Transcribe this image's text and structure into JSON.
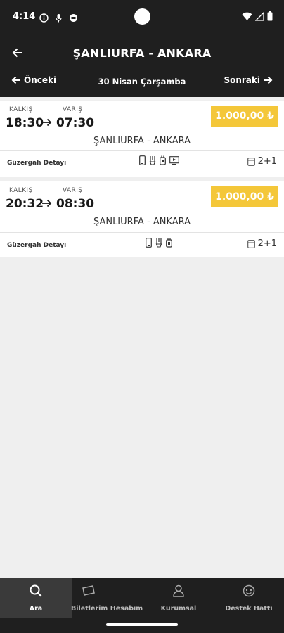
{
  "status_bar": {
    "time": "4:14"
  },
  "header": {
    "title": "ŞANLIURFA - ANKARA"
  },
  "date_nav": {
    "prev_label": "Önceki",
    "current_date": "30 Nisan Çarşamba",
    "next_label": "Sonraki"
  },
  "trips": [
    {
      "departure_label": "KALKIŞ",
      "arrival_label": "VARIŞ",
      "departure_time": "18:30",
      "arrival_time": "07:30",
      "price": "1.000,00 ₺",
      "route": "ŞANLIURFA - ANKARA",
      "detail_label": "Güzergah Detayı",
      "seat_layout": "2+1",
      "amenities": [
        "phone-icon",
        "usb-charge-icon",
        "socket-icon",
        "tv-icon"
      ]
    },
    {
      "departure_label": "KALKIŞ",
      "arrival_label": "VARIŞ",
      "departure_time": "20:32",
      "arrival_time": "08:30",
      "price": "1.000,00 ₺",
      "route": "ŞANLIURFA - ANKARA",
      "detail_label": "Güzergah Detayı",
      "seat_layout": "2+1",
      "amenities": [
        "phone-icon",
        "usb-charge-icon",
        "socket-icon"
      ]
    }
  ],
  "bottom_nav": {
    "items": [
      {
        "label": "Ara",
        "icon": "search-icon",
        "active": true
      },
      {
        "label": "Biletlerim",
        "icon": "ticket-icon",
        "active": false
      },
      {
        "label": "Hesabım",
        "icon": "",
        "active": false
      },
      {
        "label": "Kurumsal",
        "icon": "user-icon",
        "active": false
      },
      {
        "label": "Destek Hattı",
        "icon": "support-icon",
        "active": false
      }
    ]
  },
  "colors": {
    "header_bg": "#1f1f1f",
    "price_bg": "#f4c739",
    "page_bg": "#efefef"
  }
}
